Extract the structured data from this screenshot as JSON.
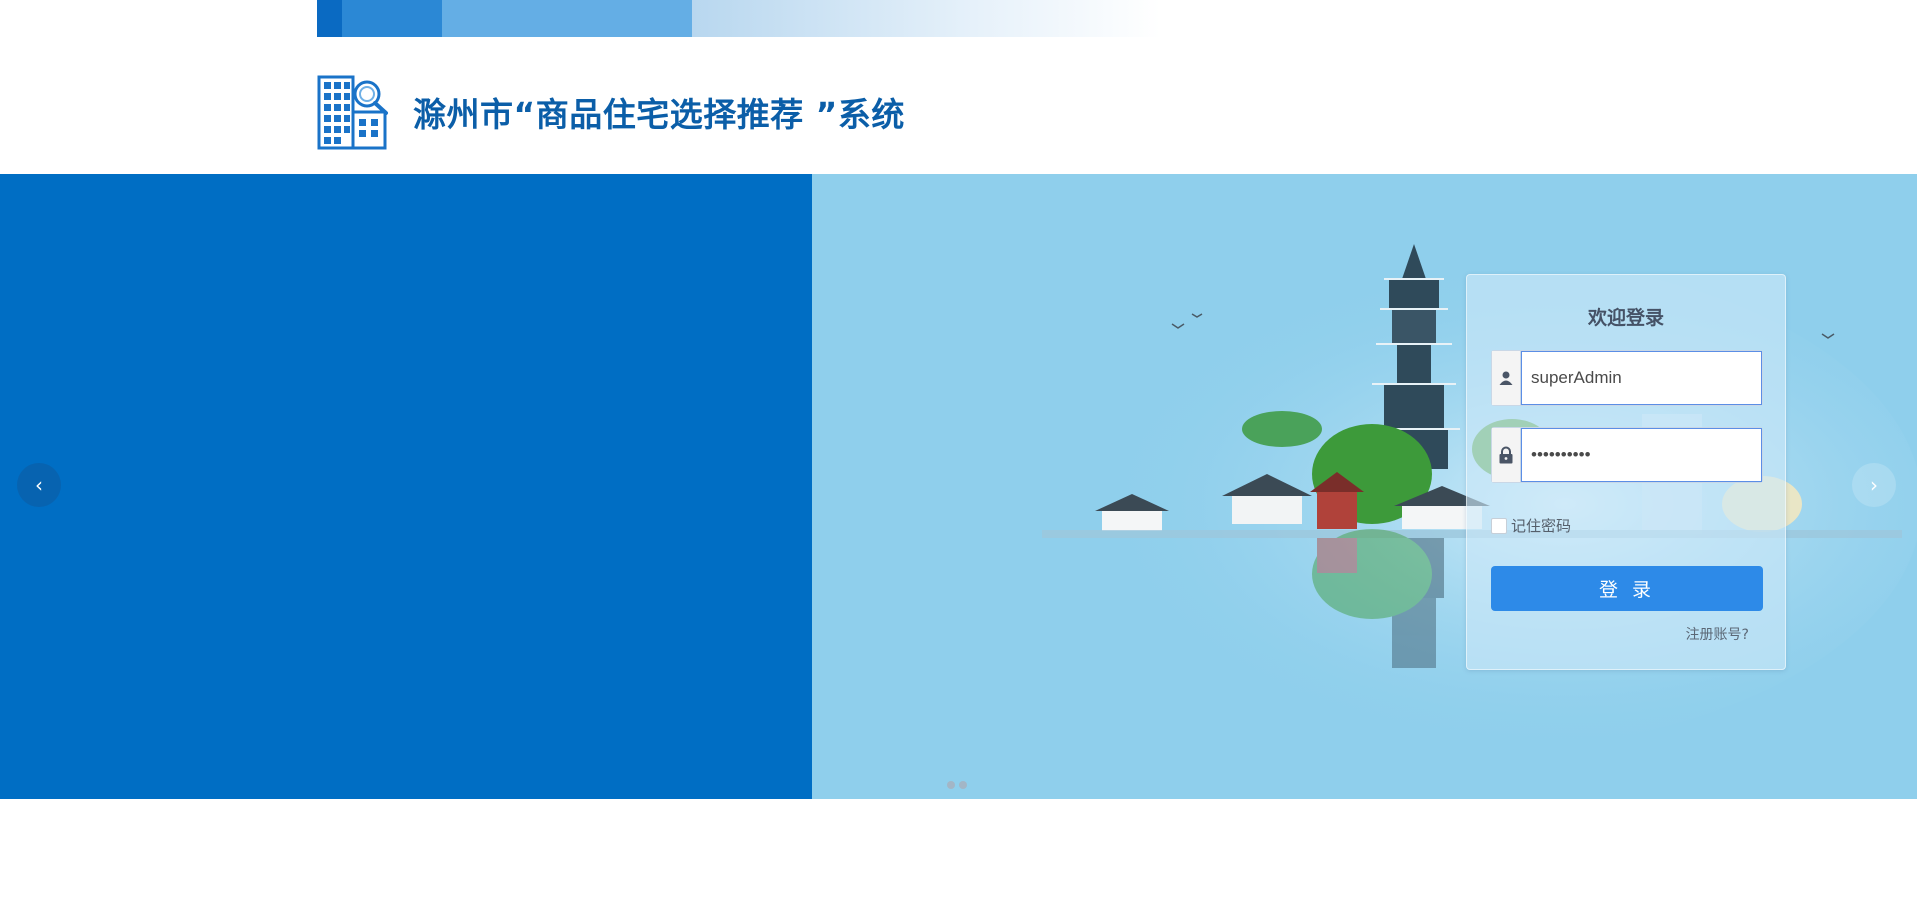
{
  "header": {
    "title": "滁州市“商品住宅选择推荐 ”系统",
    "logo_icon": "building-search-icon"
  },
  "banner": {
    "prev_label": "‹",
    "next_label": "›",
    "slide_count": 2,
    "colors": {
      "left_panel": "#006ec4",
      "right_panel": "#8fcfec"
    }
  },
  "login": {
    "title": "欢迎登录",
    "username": {
      "value": "superAdmin",
      "icon": "user-icon"
    },
    "password": {
      "value": "••••••••••",
      "icon": "lock-icon"
    },
    "remember_label": "记住密码",
    "remember_checked": false,
    "submit_label": "登 录",
    "register_label": "注册账号?"
  },
  "colors": {
    "accent": "#2d8ae8",
    "title": "#0b5ea8"
  }
}
